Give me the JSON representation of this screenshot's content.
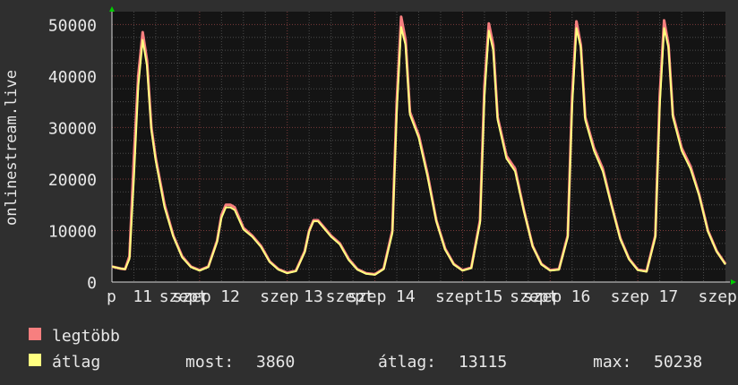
{
  "chart_data": {
    "type": "line",
    "ylabel": "onlinestream.live",
    "ylim": [
      0,
      52500
    ],
    "yticks": [
      0,
      10000,
      20000,
      30000,
      40000,
      50000
    ],
    "ytick_labels": [
      "0",
      "10000",
      "20000",
      "30000",
      "40000",
      "50000"
    ],
    "xlim": [
      0,
      7
    ],
    "xtick_labels": [
      {
        "x": 0.0,
        "label": "p"
      },
      {
        "x": 0.3,
        "label": "11"
      },
      {
        "x": 0.6,
        "label": "szept"
      },
      {
        "x": 0.75,
        "label": "szep"
      },
      {
        "x": 1.3,
        "label": "12"
      },
      {
        "x": 1.75,
        "label": "szep"
      },
      {
        "x": 2.25,
        "label": "13"
      },
      {
        "x": 2.5,
        "label": "szept"
      },
      {
        "x": 2.75,
        "label": "szep"
      },
      {
        "x": 3.3,
        "label": "14"
      },
      {
        "x": 3.75,
        "label": "szept"
      },
      {
        "x": 4.3,
        "label": "15"
      },
      {
        "x": 4.6,
        "label": "szept"
      },
      {
        "x": 4.75,
        "label": "szep"
      },
      {
        "x": 5.3,
        "label": "16"
      },
      {
        "x": 5.75,
        "label": "szep"
      },
      {
        "x": 6.3,
        "label": "17"
      },
      {
        "x": 6.75,
        "label": "szep"
      }
    ],
    "grid": true,
    "series": [
      {
        "name": "legtöbb",
        "color": "#f77f7f",
        "x": [
          0,
          0.1,
          0.15,
          0.2,
          0.25,
          0.3,
          0.35,
          0.4,
          0.45,
          0.5,
          0.6,
          0.7,
          0.8,
          0.9,
          1,
          1.1,
          1.2,
          1.25,
          1.3,
          1.35,
          1.4,
          1.5,
          1.6,
          1.7,
          1.8,
          1.9,
          2,
          2.1,
          2.2,
          2.25,
          2.3,
          2.35,
          2.4,
          2.5,
          2.6,
          2.7,
          2.8,
          2.9,
          3,
          3.1,
          3.2,
          3.25,
          3.3,
          3.35,
          3.4,
          3.5,
          3.6,
          3.7,
          3.8,
          3.9,
          4,
          4.1,
          4.2,
          4.25,
          4.3,
          4.35,
          4.4,
          4.5,
          4.6,
          4.7,
          4.8,
          4.9,
          5,
          5.1,
          5.2,
          5.25,
          5.3,
          5.35,
          5.4,
          5.5,
          5.6,
          5.7,
          5.8,
          5.9,
          6,
          6.1,
          6.2,
          6.25,
          6.3,
          6.35,
          6.4,
          6.5,
          6.6,
          6.7,
          6.8,
          6.9,
          7
        ],
        "y": [
          3000,
          2600,
          2500,
          5000,
          24000,
          40000,
          48500,
          43000,
          30000,
          24000,
          15000,
          9000,
          5000,
          3000,
          2300,
          3000,
          8000,
          13000,
          15000,
          15000,
          14500,
          10500,
          9000,
          7000,
          4000,
          2500,
          1800,
          2200,
          6000,
          10000,
          12000,
          12000,
          11000,
          9000,
          7500,
          4500,
          2500,
          1700,
          1500,
          2600,
          10000,
          35000,
          51500,
          47000,
          33000,
          28500,
          21000,
          12000,
          6500,
          3500,
          2300,
          2800,
          12000,
          38000,
          50200,
          46000,
          32000,
          24500,
          22000,
          14000,
          7000,
          3500,
          2300,
          2500,
          9000,
          36000,
          50600,
          46000,
          32000,
          26000,
          22000,
          15000,
          8500,
          4500,
          2400,
          2100,
          9000,
          36000,
          50800,
          46000,
          32500,
          26000,
          22500,
          17000,
          10000,
          6000,
          3500
        ]
      },
      {
        "name": "átlag",
        "color": "#ffff80",
        "x": [
          0,
          0.1,
          0.15,
          0.2,
          0.25,
          0.3,
          0.35,
          0.4,
          0.45,
          0.5,
          0.6,
          0.7,
          0.8,
          0.9,
          1,
          1.1,
          1.2,
          1.25,
          1.3,
          1.35,
          1.4,
          1.5,
          1.6,
          1.7,
          1.8,
          1.9,
          2,
          2.1,
          2.2,
          2.25,
          2.3,
          2.35,
          2.4,
          2.5,
          2.6,
          2.7,
          2.8,
          2.9,
          3,
          3.1,
          3.2,
          3.25,
          3.3,
          3.35,
          3.4,
          3.5,
          3.6,
          3.7,
          3.8,
          3.9,
          4,
          4.1,
          4.2,
          4.25,
          4.3,
          4.35,
          4.4,
          4.5,
          4.6,
          4.7,
          4.8,
          4.9,
          5,
          5.1,
          5.2,
          5.25,
          5.3,
          5.35,
          5.4,
          5.5,
          5.6,
          5.7,
          5.8,
          5.9,
          6,
          6.1,
          6.2,
          6.25,
          6.3,
          6.35,
          6.4,
          6.5,
          6.6,
          6.7,
          6.8,
          6.9,
          7
        ],
        "y": [
          3000,
          2600,
          2500,
          4500,
          20000,
          38000,
          47000,
          42000,
          29500,
          23500,
          14500,
          8800,
          4800,
          2900,
          2200,
          2900,
          7800,
          12500,
          14500,
          14500,
          14000,
          10200,
          8800,
          6800,
          3900,
          2400,
          1700,
          2100,
          5800,
          9800,
          11800,
          11800,
          10800,
          8800,
          7300,
          4300,
          2400,
          1600,
          1400,
          2500,
          9500,
          33000,
          49500,
          46000,
          32500,
          28000,
          20500,
          11800,
          6300,
          3400,
          2200,
          2700,
          11500,
          36000,
          48800,
          45000,
          31500,
          24000,
          21500,
          13800,
          6900,
          3400,
          2200,
          2400,
          8700,
          34000,
          49300,
          45500,
          31500,
          25500,
          21500,
          14800,
          8300,
          4400,
          2300,
          2000,
          8700,
          34000,
          49300,
          45500,
          32000,
          25500,
          22000,
          16800,
          9800,
          5900,
          3400
        ]
      }
    ]
  },
  "legend": [
    {
      "label": "legtöbb",
      "color": "#f77f7f"
    },
    {
      "label": "átlag",
      "color": "#ffff80"
    }
  ],
  "stats": {
    "now_label": "most:",
    "now_value": "3860",
    "avg_label": "átlag:",
    "avg_value": "13115",
    "max_label": "max:",
    "max_value": "50238"
  }
}
